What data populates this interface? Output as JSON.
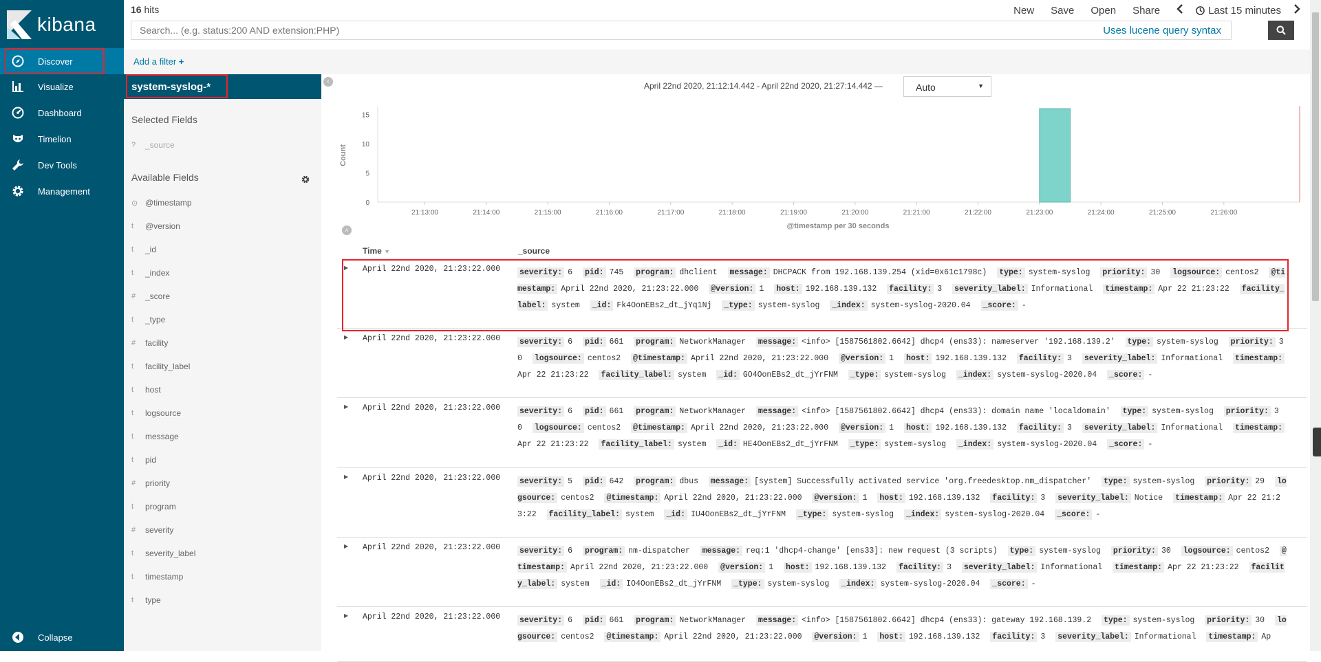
{
  "nav": {
    "logo_text": "kibana",
    "items": [
      {
        "label": "Discover",
        "icon": "compass-icon"
      },
      {
        "label": "Visualize",
        "icon": "bar-chart-icon"
      },
      {
        "label": "Dashboard",
        "icon": "dashboard-gauge-icon"
      },
      {
        "label": "Timelion",
        "icon": "timelion-mask-icon"
      },
      {
        "label": "Dev Tools",
        "icon": "wrench-icon"
      },
      {
        "label": "Management",
        "icon": "gear-icon"
      }
    ],
    "collapse_label": "Collapse"
  },
  "topbar": {
    "hits_count": "16",
    "hits_label": "hits",
    "menu": [
      "New",
      "Save",
      "Open",
      "Share"
    ],
    "time_label": "Last 15 minutes"
  },
  "search": {
    "placeholder": "Search... (e.g. status:200 AND extension:PHP)",
    "lucene_link": "Uses lucene query syntax"
  },
  "filter": {
    "add_label": "Add a filter"
  },
  "sidebar": {
    "index_pattern": "system-syslog-*",
    "selected_heading": "Selected Fields",
    "selected_fields": [
      {
        "type": "?",
        "name": "_source"
      }
    ],
    "available_heading": "Available Fields",
    "available_fields": [
      {
        "type": "⊙",
        "name": "@timestamp"
      },
      {
        "type": "t",
        "name": "@version"
      },
      {
        "type": "t",
        "name": "_id"
      },
      {
        "type": "t",
        "name": "_index"
      },
      {
        "type": "#",
        "name": "_score"
      },
      {
        "type": "t",
        "name": "_type"
      },
      {
        "type": "#",
        "name": "facility"
      },
      {
        "type": "t",
        "name": "facility_label"
      },
      {
        "type": "t",
        "name": "host"
      },
      {
        "type": "t",
        "name": "logsource"
      },
      {
        "type": "t",
        "name": "message"
      },
      {
        "type": "t",
        "name": "pid"
      },
      {
        "type": "#",
        "name": "priority"
      },
      {
        "type": "t",
        "name": "program"
      },
      {
        "type": "#",
        "name": "severity"
      },
      {
        "type": "t",
        "name": "severity_label"
      },
      {
        "type": "t",
        "name": "timestamp"
      },
      {
        "type": "t",
        "name": "type"
      }
    ]
  },
  "histogram": {
    "time_range": "April 22nd 2020, 21:12:14.442 - April 22nd 2020, 21:27:14.442 —",
    "interval": "Auto"
  },
  "chart_data": {
    "type": "bar",
    "xlabel": "@timestamp per 30 seconds",
    "ylabel": "Count",
    "ylim": [
      0,
      16
    ],
    "yticks": [
      0,
      5,
      10,
      15
    ],
    "xticks": [
      "21:13:00",
      "21:14:00",
      "21:15:00",
      "21:16:00",
      "21:17:00",
      "21:18:00",
      "21:19:00",
      "21:20:00",
      "21:21:00",
      "21:22:00",
      "21:23:00",
      "21:24:00",
      "21:25:00",
      "21:26:00"
    ],
    "x_domain": [
      "21:12:14",
      "21:27:14"
    ],
    "bars": [
      {
        "x": "21:23:00",
        "width_seconds": 30,
        "value": 16
      }
    ],
    "bar_color": "#7ed3cb"
  },
  "table": {
    "col_time": "Time",
    "col_source": "_source",
    "rows": [
      {
        "time": "April 22nd 2020, 21:23:22.000",
        "fields": [
          [
            "severity:",
            "6"
          ],
          [
            "pid:",
            "745"
          ],
          [
            "program:",
            "dhclient"
          ],
          [
            "message:",
            "DHCPACK from 192.168.139.254 (xid=0x61c1798c)"
          ],
          [
            "type:",
            "system-syslog"
          ],
          [
            "priority:",
            "30"
          ],
          [
            "logsource:",
            "centos2"
          ],
          [
            "@timestamp:",
            "April 22nd 2020, 21:23:22.000"
          ],
          [
            "@version:",
            "1"
          ],
          [
            "host:",
            "192.168.139.132"
          ],
          [
            "facility:",
            "3"
          ],
          [
            "severity_label:",
            "Informational"
          ],
          [
            "timestamp:",
            "Apr 22 21:23:22"
          ],
          [
            "facility_label:",
            "system"
          ],
          [
            "_id:",
            "Fk4OonEBs2_dt_jYq1Nj"
          ],
          [
            "_type:",
            "system-syslog"
          ],
          [
            "_index:",
            "system-syslog-2020.04"
          ],
          [
            "_score:",
            "-"
          ]
        ]
      },
      {
        "time": "April 22nd 2020, 21:23:22.000",
        "fields": [
          [
            "severity:",
            "6"
          ],
          [
            "pid:",
            "661"
          ],
          [
            "program:",
            "NetworkManager"
          ],
          [
            "message:",
            "<info> [1587561802.6642] dhcp4 (ens33): nameserver '192.168.139.2'"
          ],
          [
            "type:",
            "system-syslog"
          ],
          [
            "priority:",
            "30"
          ],
          [
            "logsource:",
            "centos2"
          ],
          [
            "@timestamp:",
            "April 22nd 2020, 21:23:22.000"
          ],
          [
            "@version:",
            "1"
          ],
          [
            "host:",
            "192.168.139.132"
          ],
          [
            "facility:",
            "3"
          ],
          [
            "severity_label:",
            "Informational"
          ],
          [
            "timestamp:",
            "Apr 22 21:23:22"
          ],
          [
            "facility_label:",
            "system"
          ],
          [
            "_id:",
            "GO4OonEBs2_dt_jYrFNM"
          ],
          [
            "_type:",
            "system-syslog"
          ],
          [
            "_index:",
            "system-syslog-2020.04"
          ],
          [
            "_score:",
            "-"
          ]
        ]
      },
      {
        "time": "April 22nd 2020, 21:23:22.000",
        "fields": [
          [
            "severity:",
            "6"
          ],
          [
            "pid:",
            "661"
          ],
          [
            "program:",
            "NetworkManager"
          ],
          [
            "message:",
            "<info> [1587561802.6642] dhcp4 (ens33): domain name 'localdomain'"
          ],
          [
            "type:",
            "system-syslog"
          ],
          [
            "priority:",
            "30"
          ],
          [
            "logsource:",
            "centos2"
          ],
          [
            "@timestamp:",
            "April 22nd 2020, 21:23:22.000"
          ],
          [
            "@version:",
            "1"
          ],
          [
            "host:",
            "192.168.139.132"
          ],
          [
            "facility:",
            "3"
          ],
          [
            "severity_label:",
            "Informational"
          ],
          [
            "timestamp:",
            "Apr 22 21:23:22"
          ],
          [
            "facility_label:",
            "system"
          ],
          [
            "_id:",
            "HE4OonEBs2_dt_jYrFNM"
          ],
          [
            "_type:",
            "system-syslog"
          ],
          [
            "_index:",
            "system-syslog-2020.04"
          ],
          [
            "_score:",
            "-"
          ]
        ]
      },
      {
        "time": "April 22nd 2020, 21:23:22.000",
        "fields": [
          [
            "severity:",
            "5"
          ],
          [
            "pid:",
            "642"
          ],
          [
            "program:",
            "dbus"
          ],
          [
            "message:",
            "[system] Successfully activated service 'org.freedesktop.nm_dispatcher'"
          ],
          [
            "type:",
            "system-syslog"
          ],
          [
            "priority:",
            "29"
          ],
          [
            "logsource:",
            "centos2"
          ],
          [
            "@timestamp:",
            "April 22nd 2020, 21:23:22.000"
          ],
          [
            "@version:",
            "1"
          ],
          [
            "host:",
            "192.168.139.132"
          ],
          [
            "facility:",
            "3"
          ],
          [
            "severity_label:",
            "Notice"
          ],
          [
            "timestamp:",
            "Apr 22 21:23:22"
          ],
          [
            "facility_label:",
            "system"
          ],
          [
            "_id:",
            "IU4OonEBs2_dt_jYrFNM"
          ],
          [
            "_type:",
            "system-syslog"
          ],
          [
            "_index:",
            "system-syslog-2020.04"
          ],
          [
            "_score:",
            "-"
          ]
        ]
      },
      {
        "time": "April 22nd 2020, 21:23:22.000",
        "fields": [
          [
            "severity:",
            "6"
          ],
          [
            "program:",
            "nm-dispatcher"
          ],
          [
            "message:",
            "req:1 'dhcp4-change' [ens33]: new request (3 scripts)"
          ],
          [
            "type:",
            "system-syslog"
          ],
          [
            "priority:",
            "30"
          ],
          [
            "logsource:",
            "centos2"
          ],
          [
            "@timestamp:",
            "April 22nd 2020, 21:23:22.000"
          ],
          [
            "@version:",
            "1"
          ],
          [
            "host:",
            "192.168.139.132"
          ],
          [
            "facility:",
            "3"
          ],
          [
            "severity_label:",
            "Informational"
          ],
          [
            "timestamp:",
            "Apr 22 21:23:22"
          ],
          [
            "facility_label:",
            "system"
          ],
          [
            "_id:",
            "IO4OonEBs2_dt_jYrFNM"
          ],
          [
            "_type:",
            "system-syslog"
          ],
          [
            "_index:",
            "system-syslog-2020.04"
          ],
          [
            "_score:",
            "-"
          ]
        ]
      },
      {
        "time": "April 22nd 2020, 21:23:22.000",
        "fields": [
          [
            "severity:",
            "6"
          ],
          [
            "pid:",
            "661"
          ],
          [
            "program:",
            "NetworkManager"
          ],
          [
            "message:",
            "<info> [1587561802.6642] dhcp4 (ens33): gateway 192.168.139.2"
          ],
          [
            "type:",
            "system-syslog"
          ],
          [
            "priority:",
            "30"
          ],
          [
            "logsource:",
            "centos2"
          ],
          [
            "@timestamp:",
            "April 22nd 2020, 21:23:22.000"
          ],
          [
            "@version:",
            "1"
          ],
          [
            "host:",
            "192.168.139.132"
          ],
          [
            "facility:",
            "3"
          ],
          [
            "severity_label:",
            "Informational"
          ],
          [
            "timestamp:",
            "Ap"
          ]
        ]
      }
    ]
  },
  "colors": {
    "nav_bg": "#005571",
    "nav_active": "#0079a5",
    "link": "#0079a5",
    "highlight_box": "#e8232a",
    "bar": "#7ed3cb"
  }
}
